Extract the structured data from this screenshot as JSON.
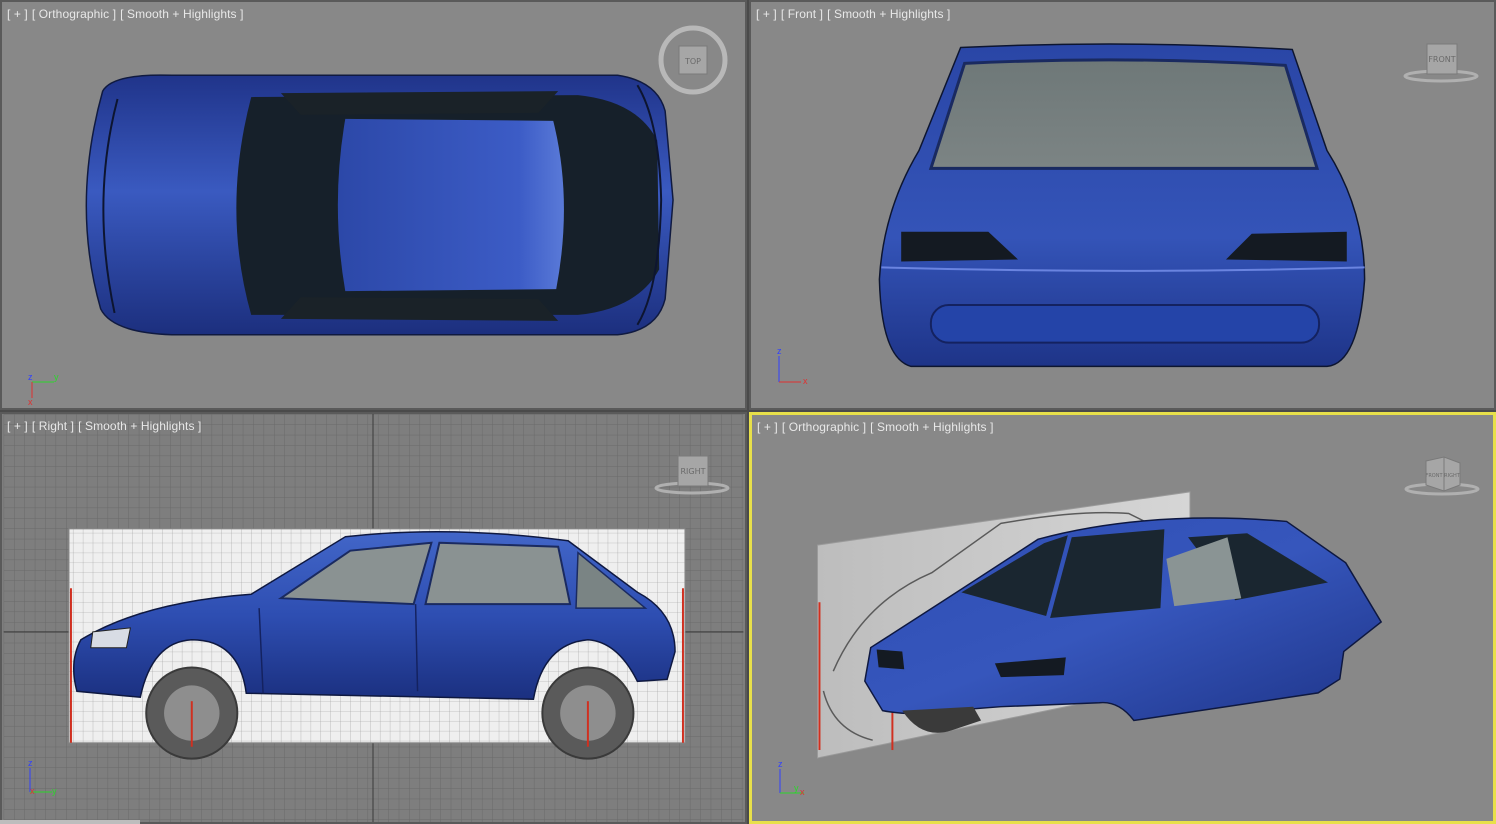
{
  "viewports": {
    "top_left": {
      "labels": [
        "[ + ]",
        "[ Orthographic ]",
        "[ Smooth + Highlights ]"
      ],
      "gizmo": "TOP",
      "axis": {
        "a": "z",
        "b": "y",
        "c": "x"
      }
    },
    "top_right": {
      "labels": [
        "[ + ]",
        "[ Front ]",
        "[ Smooth + Highlights ]"
      ],
      "gizmo": "FRONT",
      "axis": {
        "a": "z",
        "b": "x"
      }
    },
    "bottom_left": {
      "labels": [
        "[ + ]",
        "[ Right ]",
        "[ Smooth + Highlights ]"
      ],
      "gizmo": "RIGHT",
      "axis": {
        "a": "z",
        "b": "x",
        "c": "y"
      }
    },
    "bottom_right": {
      "labels": [
        "[ + ]",
        "[ Orthographic ]",
        "[ Smooth + Highlights ]"
      ],
      "gizmo_front": "FRONT",
      "gizmo_right": "RIGHT",
      "axis": {
        "a": "z",
        "b": "y",
        "c": "x"
      }
    }
  },
  "colors": {
    "viewport_bg": "#888888",
    "active_border": "#e8e04a",
    "car_body": "#2a45a0",
    "glass": "#1a2226"
  }
}
